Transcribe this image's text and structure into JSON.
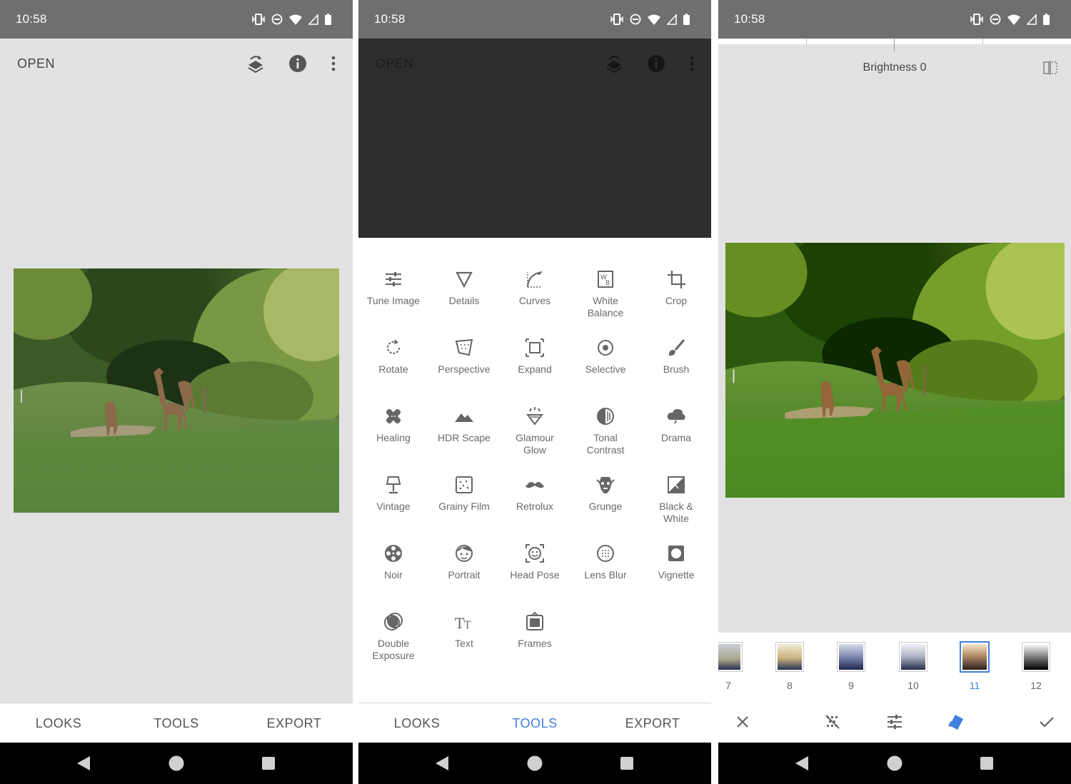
{
  "status_bar": {
    "time": "10:58"
  },
  "screen1": {
    "top_bar": {
      "open_label": "OPEN",
      "icons": [
        "layers-undo-icon",
        "info-icon",
        "more-vert-icon"
      ]
    },
    "tabs": [
      "LOOKS",
      "TOOLS",
      "EXPORT"
    ]
  },
  "screen2": {
    "top_bar": {
      "open_label": "OPEN"
    },
    "tools": [
      {
        "label": "Tune Image",
        "icon": "tune-icon"
      },
      {
        "label": "Details",
        "icon": "details-triangle-icon"
      },
      {
        "label": "Curves",
        "icon": "curves-icon"
      },
      {
        "label": "White Balance",
        "icon": "white-balance-icon"
      },
      {
        "label": "Crop",
        "icon": "crop-icon"
      },
      {
        "label": "Rotate",
        "icon": "rotate-icon"
      },
      {
        "label": "Perspective",
        "icon": "perspective-icon"
      },
      {
        "label": "Expand",
        "icon": "expand-icon"
      },
      {
        "label": "Selective",
        "icon": "selective-icon"
      },
      {
        "label": "Brush",
        "icon": "brush-icon"
      },
      {
        "label": "Healing",
        "icon": "healing-icon"
      },
      {
        "label": "HDR Scape",
        "icon": "hdr-mountain-icon"
      },
      {
        "label": "Glamour Glow",
        "icon": "glamour-glow-icon"
      },
      {
        "label": "Tonal Contrast",
        "icon": "tonal-contrast-icon"
      },
      {
        "label": "Drama",
        "icon": "drama-cloud-icon"
      },
      {
        "label": "Vintage",
        "icon": "vintage-lamp-icon"
      },
      {
        "label": "Grainy Film",
        "icon": "grainy-film-icon"
      },
      {
        "label": "Retrolux",
        "icon": "retrolux-mustache-icon"
      },
      {
        "label": "Grunge",
        "icon": "grunge-icon"
      },
      {
        "label": "Black & White",
        "icon": "black-white-icon"
      },
      {
        "label": "Noir",
        "icon": "noir-reel-icon"
      },
      {
        "label": "Portrait",
        "icon": "portrait-face-icon"
      },
      {
        "label": "Head Pose",
        "icon": "head-pose-icon"
      },
      {
        "label": "Lens Blur",
        "icon": "lens-blur-icon"
      },
      {
        "label": "Vignette",
        "icon": "vignette-icon"
      },
      {
        "label": "Double Exposure",
        "icon": "double-exposure-icon"
      },
      {
        "label": "Text",
        "icon": "text-icon"
      },
      {
        "label": "Frames",
        "icon": "frames-icon"
      }
    ],
    "tabs": [
      "LOOKS",
      "TOOLS",
      "EXPORT"
    ],
    "active_tab": "TOOLS"
  },
  "screen3": {
    "adjustment_label": "Brightness 0",
    "filters": [
      {
        "num": "7"
      },
      {
        "num": "8"
      },
      {
        "num": "9"
      },
      {
        "num": "10"
      },
      {
        "num": "11",
        "selected": true
      },
      {
        "num": "12"
      }
    ],
    "actions": [
      "cancel-icon",
      "mask-icon",
      "tune-icon",
      "style-icon",
      "check-icon"
    ]
  },
  "colors": {
    "accent": "#3f7fdd",
    "status_bar": "#6f6f6f",
    "background": "#e2e2e2"
  }
}
